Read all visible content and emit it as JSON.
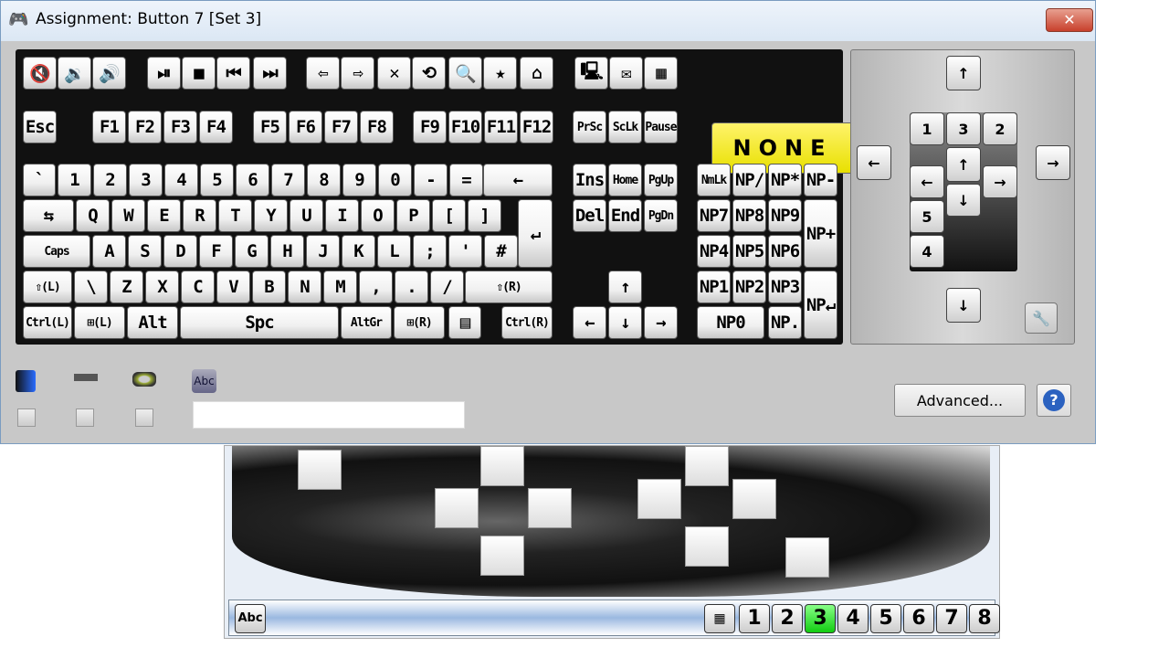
{
  "window": {
    "title": "Assignment: Button 7 [Set 3]",
    "close_label": "✕"
  },
  "keyboard": {
    "media": [
      "🔇",
      "🔉",
      "🔊",
      "⏯",
      "■",
      "⏮",
      "⏭",
      "⇦",
      "⇨",
      "✕",
      "⟲",
      "🔍",
      "★",
      "⌂",
      "🖳",
      "✉",
      "▦"
    ],
    "none_label": "NONE",
    "frow": [
      "Esc",
      "F1",
      "F2",
      "F3",
      "F4",
      "F5",
      "F6",
      "F7",
      "F8",
      "F9",
      "F10",
      "F11",
      "F12",
      "PrSc",
      "ScLk",
      "Pause"
    ],
    "row3": [
      "`",
      "1",
      "2",
      "3",
      "4",
      "5",
      "6",
      "7",
      "8",
      "9",
      "0",
      "-",
      "=",
      "←",
      "Ins",
      "Home",
      "PgUp",
      "NmLk",
      "NP/",
      "NP*",
      "NP-"
    ],
    "row4": [
      "⇆",
      "Q",
      "W",
      "E",
      "R",
      "T",
      "Y",
      "U",
      "I",
      "O",
      "P",
      "[",
      "]",
      "↵",
      "Del",
      "End",
      "PgDn",
      "NP7",
      "NP8",
      "NP9",
      "NP+"
    ],
    "row5": [
      "Caps",
      "A",
      "S",
      "D",
      "F",
      "G",
      "H",
      "J",
      "K",
      "L",
      ";",
      "'",
      "#",
      "NP4",
      "NP5",
      "NP6"
    ],
    "row6": [
      "⇧(L)",
      "\\",
      "Z",
      "X",
      "C",
      "V",
      "B",
      "N",
      "M",
      ",",
      ".",
      "/",
      "⇧(R)",
      "↑",
      "NP1",
      "NP2",
      "NP3",
      "NP↵"
    ],
    "row7": [
      "Ctrl(L)",
      "⊞(L)",
      "Alt",
      "Spc",
      "AltGr",
      "⊞(R)",
      "▤",
      "Ctrl(R)",
      "←",
      "↓",
      "→",
      "NP0",
      "NP."
    ]
  },
  "mouse_panel": {
    "up": "↑",
    "down": "↓",
    "left": "←",
    "right": "→",
    "buttons": [
      "1",
      "3",
      "2",
      "5",
      "4"
    ],
    "wheel_up": "↑",
    "wheel_down": "↓",
    "wheel_left": "←",
    "wheel_right": "→",
    "settings": "🔧"
  },
  "options": {
    "icons": [
      "turbo-icon",
      "gun-icon",
      "vibration-icon",
      "text-icon"
    ],
    "text_icon_label": "Abc",
    "text_value": ""
  },
  "advanced_label": "Advanced...",
  "help_label": "?",
  "bottom": {
    "abc": "Abc",
    "sets": [
      "1",
      "2",
      "3",
      "4",
      "5",
      "6",
      "7",
      "8"
    ],
    "active_set": "3",
    "active_color": "#22cc22"
  }
}
